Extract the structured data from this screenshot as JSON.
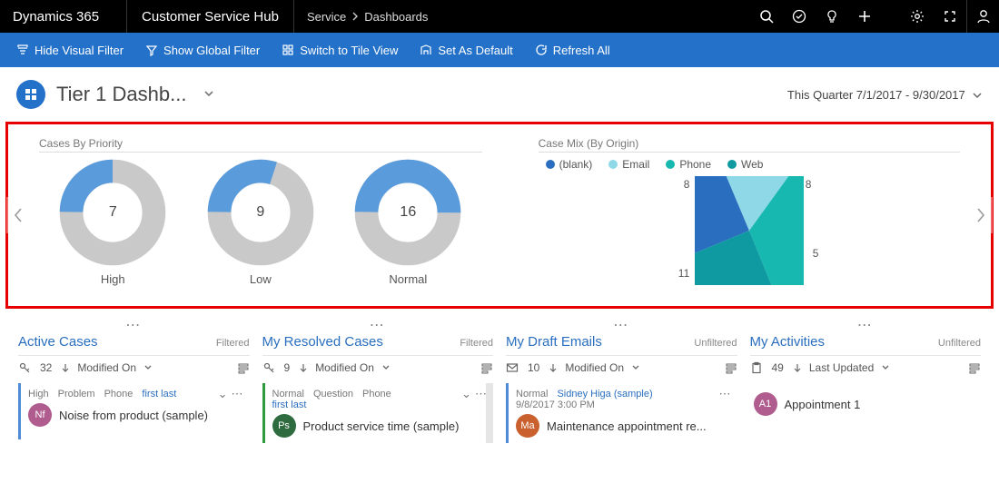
{
  "topbar": {
    "brand": "Dynamics 365",
    "app": "Customer Service Hub",
    "crumb1": "Service",
    "crumb2": "Dashboards"
  },
  "cmdbar": {
    "hide": "Hide Visual Filter",
    "global": "Show Global Filter",
    "tile": "Switch to Tile View",
    "default": "Set As Default",
    "refresh": "Refresh All"
  },
  "page": {
    "title": "Tier 1 Dashb...",
    "range": "This Quarter 7/1/2017 - 9/30/2017"
  },
  "cards": {
    "priority": {
      "title": "Cases By Priority",
      "items": [
        {
          "label": "High",
          "value": "7"
        },
        {
          "label": "Low",
          "value": "9"
        },
        {
          "label": "Normal",
          "value": "16"
        }
      ]
    },
    "mix": {
      "title": "Case Mix (By Origin)",
      "legend": [
        "(blank)",
        "Email",
        "Phone",
        "Web"
      ],
      "labels": {
        "top": "8",
        "right": "8",
        "bottomRight": "5",
        "bottomLeft": "11"
      }
    }
  },
  "streams": [
    {
      "name": "Active Cases",
      "filter": "Filtered",
      "count": "32",
      "sort": "Modified On",
      "item_tags": [
        "High",
        "Problem",
        "Phone"
      ],
      "item_link": "first last",
      "item_title": "Noise from product (sample)",
      "avatar": "Nf",
      "avatarColor": "#b05c8e",
      "border": "#4f8bd6"
    },
    {
      "name": "My Resolved Cases",
      "filter": "Filtered",
      "count": "9",
      "sort": "Modified On",
      "item_tags": [
        "Normal",
        "Question",
        "Phone"
      ],
      "item_link": "first last",
      "item_title": "Product service time (sample)",
      "avatar": "Ps",
      "avatarColor": "#2e6b3e",
      "border": "#2e9b3e"
    },
    {
      "name": "My Draft Emails",
      "filter": "Unfiltered",
      "count": "10",
      "sort": "Modified On",
      "item_tags": [
        "Normal"
      ],
      "item_link": "Sidney Higa (sample)",
      "item_sub": "9/8/2017 3:00 PM",
      "item_title": "Maintenance appointment re...",
      "avatar": "Ma",
      "avatarColor": "#c9602e",
      "border": "#4f8bd6"
    },
    {
      "name": "My Activities",
      "filter": "Unfiltered",
      "count": "49",
      "sort": "Last Updated",
      "item_title": "Appointment 1",
      "avatar": "A1",
      "avatarColor": "#b05c8e",
      "border": "none"
    }
  ],
  "chart_data": [
    {
      "type": "pie",
      "title": "Cases By Priority — High",
      "categories": [
        "segment-a",
        "segment-b"
      ],
      "values": [
        25,
        75
      ],
      "center_label": 7
    },
    {
      "type": "pie",
      "title": "Cases By Priority — Low",
      "categories": [
        "segment-a",
        "segment-b"
      ],
      "values": [
        30,
        70
      ],
      "center_label": 9
    },
    {
      "type": "pie",
      "title": "Cases By Priority — Normal",
      "categories": [
        "segment-a",
        "segment-b"
      ],
      "values": [
        50,
        50
      ],
      "center_label": 16
    },
    {
      "type": "pie",
      "title": "Case Mix (By Origin)",
      "categories": [
        "(blank)",
        "Email",
        "Phone",
        "Web"
      ],
      "values": [
        8,
        5,
        11,
        8
      ],
      "colors": [
        "#2a6fbf",
        "#8fd8e8",
        "#17b8b0",
        "#0e9aa0"
      ]
    }
  ]
}
